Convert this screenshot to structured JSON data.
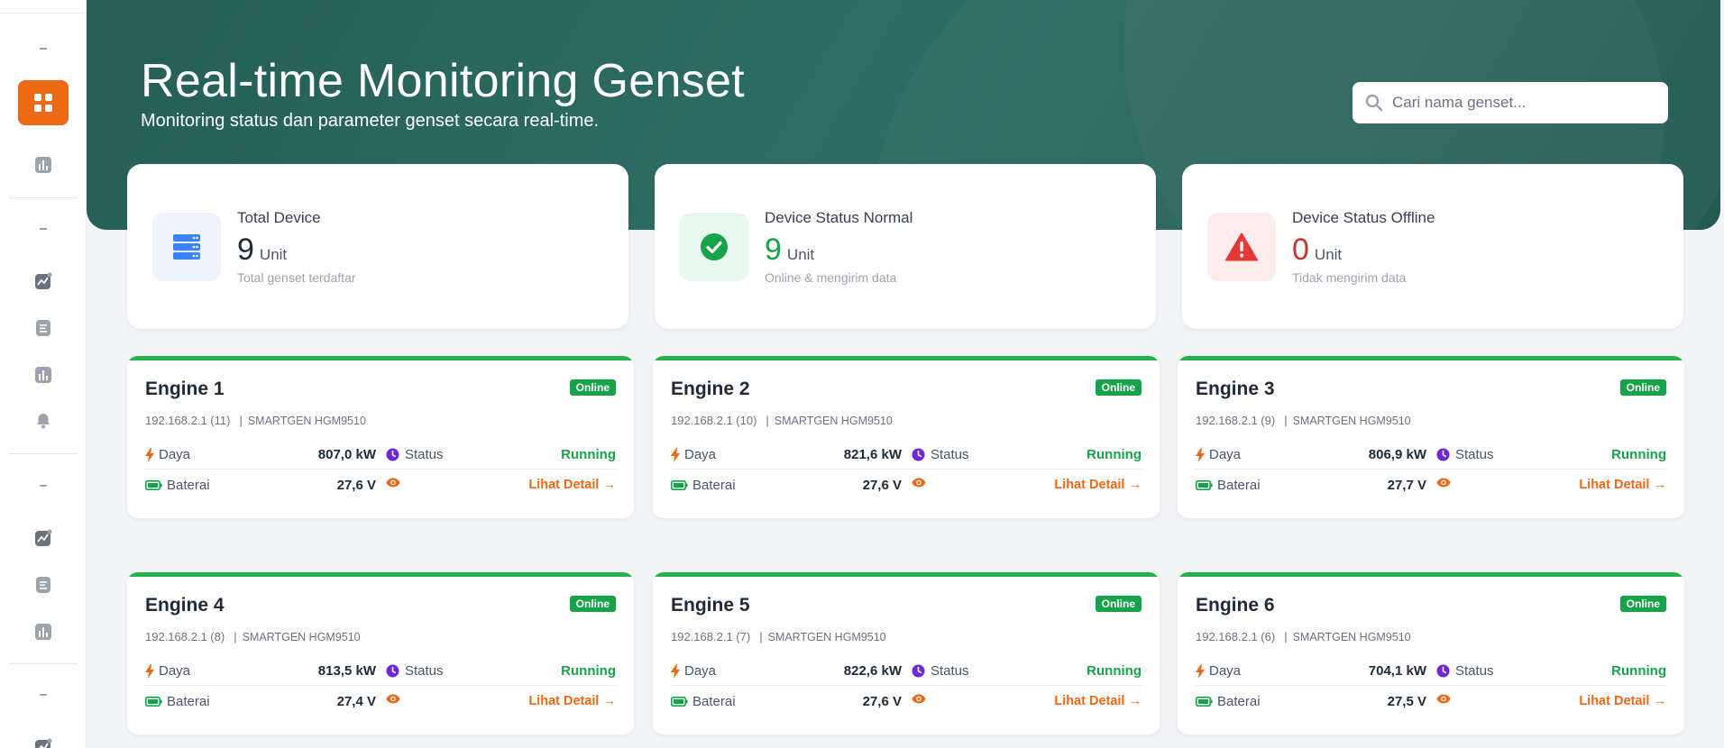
{
  "header": {
    "title": "Real-time Monitoring Genset",
    "subtitle": "Monitoring status dan parameter genset secara real-time."
  },
  "search": {
    "placeholder": "Cari nama genset..."
  },
  "summary": [
    {
      "label": "Total Device",
      "value": "9",
      "unit": "Unit",
      "desc": "Total genset terdaftar",
      "color": "#1f2937",
      "icon": "server-icon"
    },
    {
      "label": "Device Status Normal",
      "value": "9",
      "unit": "Unit",
      "desc": "Online & mengirim data",
      "color": "#17a34a",
      "icon": "check-circle-icon"
    },
    {
      "label": "Device Status Offline",
      "value": "0",
      "unit": "Unit",
      "desc": "Tidak mengirim data",
      "color": "#c0392b",
      "icon": "warning-triangle-icon"
    }
  ],
  "labels": {
    "power": "Daya",
    "status": "Status",
    "battery": "Baterai",
    "detail": "Lihat Detail →",
    "separator": "|"
  },
  "engines": [
    {
      "name": "Engine 1",
      "badge": "Online",
      "ip": "192.168.2.1 (11)",
      "model": "SMARTGEN HGM9510",
      "power": "807,0 kW",
      "status": "Running",
      "battery": "27,6 V"
    },
    {
      "name": "Engine 2",
      "badge": "Online",
      "ip": "192.168.2.1 (10)",
      "model": "SMARTGEN HGM9510",
      "power": "821,6 kW",
      "status": "Running",
      "battery": "27,6 V"
    },
    {
      "name": "Engine 3",
      "badge": "Online",
      "ip": "192.168.2.1 (9)",
      "model": "SMARTGEN HGM9510",
      "power": "806,9 kW",
      "status": "Running",
      "battery": "27,7 V"
    },
    {
      "name": "Engine 4",
      "badge": "Online",
      "ip": "192.168.2.1 (8)",
      "model": "SMARTGEN HGM9510",
      "power": "813,5 kW",
      "status": "Running",
      "battery": "27,4 V"
    },
    {
      "name": "Engine 5",
      "badge": "Online",
      "ip": "192.168.2.1 (7)",
      "model": "SMARTGEN HGM9510",
      "power": "822,6 kW",
      "status": "Running",
      "battery": "27,6 V"
    },
    {
      "name": "Engine 6",
      "badge": "Online",
      "ip": "192.168.2.1 (6)",
      "model": "SMARTGEN HGM9510",
      "power": "704,1 kW",
      "status": "Running",
      "battery": "27,5 V"
    }
  ],
  "colors": {
    "accent": "#ea6a15",
    "online": "#17a34a",
    "hero": "#2d6d65"
  }
}
